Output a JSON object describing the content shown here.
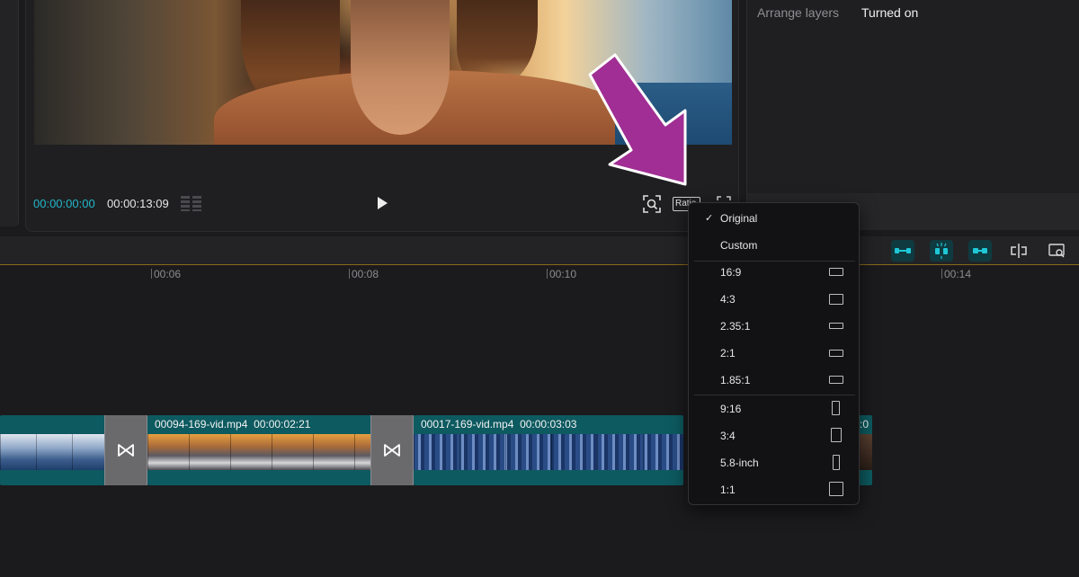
{
  "player": {
    "current_time": "00:00:00:00",
    "total_time": "00:00:13:09",
    "ratio_label": "Ratio"
  },
  "properties": {
    "arrange_layers_label": "Arrange layers",
    "arrange_layers_value": "Turned on"
  },
  "timeline": {
    "ticks": [
      "00:06",
      "00:08",
      "00:10",
      "00:14"
    ],
    "clips": [
      {
        "name": "00094-169-vid.mp4",
        "duration": "00:00:02:21"
      },
      {
        "name": "00017-169-vid.mp4",
        "duration": "00:00:03:03"
      }
    ],
    "trailing_clip_fragment": ":0"
  },
  "ratio_menu": {
    "selected": "Original",
    "items": [
      {
        "label": "Original",
        "checked": true
      },
      {
        "label": "Custom"
      },
      {
        "label": "16:9",
        "shape": "landscape"
      },
      {
        "label": "4:3",
        "shape": "landscape"
      },
      {
        "label": "2.35:1",
        "shape": "landscape"
      },
      {
        "label": "2:1",
        "shape": "landscape"
      },
      {
        "label": "1.85:1",
        "shape": "landscape"
      },
      {
        "label": "9:16",
        "shape": "portrait"
      },
      {
        "label": "3:4",
        "shape": "portrait"
      },
      {
        "label": "5.8-inch",
        "shape": "portrait"
      },
      {
        "label": "1:1",
        "shape": "square"
      }
    ]
  },
  "colors": {
    "accent_timecode": "#21b8cc",
    "clip_track": "#0d5a60",
    "annotation_arrow": "#a12e94",
    "active_tool": "#1fc7d6"
  },
  "icons": {
    "play": "play-icon",
    "zoom_fit": "zoom-fit-icon",
    "fullscreen": "fullscreen-icon",
    "transition": "bowtie-transition-icon",
    "check": "check-icon"
  }
}
